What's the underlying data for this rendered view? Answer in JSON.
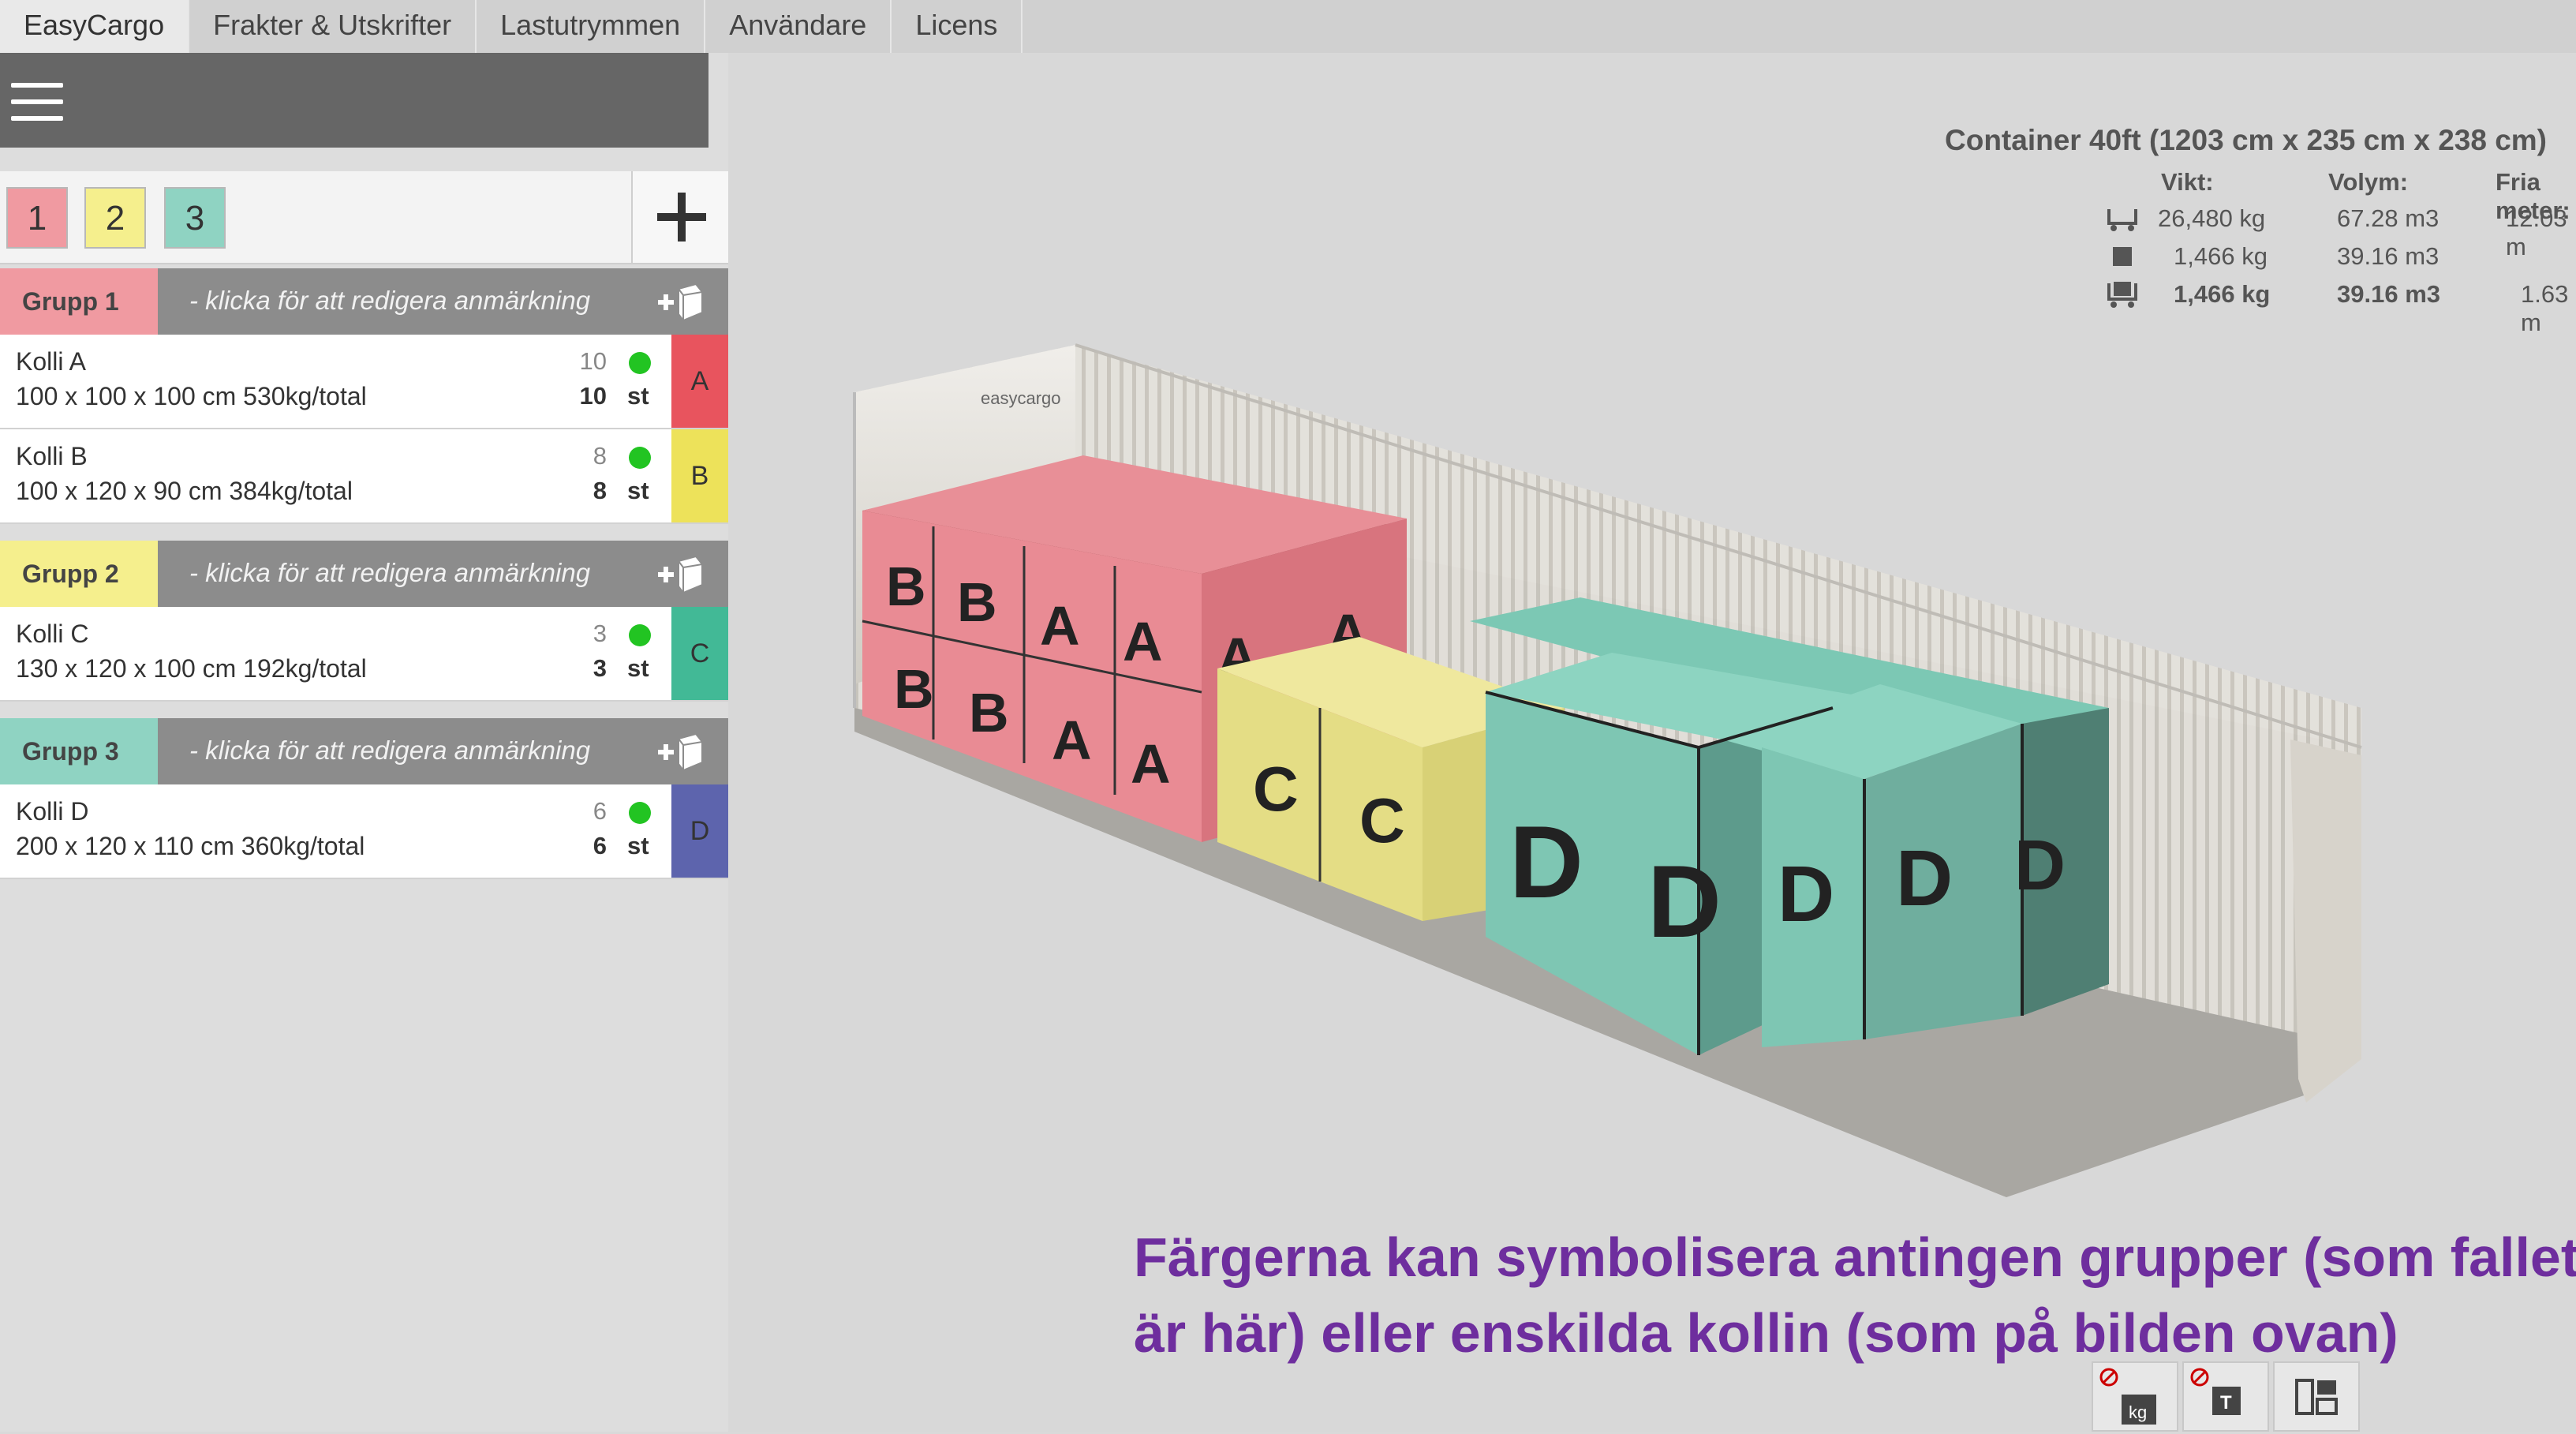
{
  "nav": {
    "tabs": [
      {
        "label": "EasyCargo"
      },
      {
        "label": "Frakter & Utskrifter"
      },
      {
        "label": "Lastutrymmen"
      },
      {
        "label": "Användare"
      },
      {
        "label": "Licens"
      }
    ]
  },
  "group_tabs": [
    "1",
    "2",
    "3"
  ],
  "groups": [
    {
      "label": "Grupp 1",
      "note": "- klicka för att redigera anmärkning",
      "color": "#f09aa1",
      "items": [
        {
          "name": "Kolli A",
          "dims": "100 x 100 x 100 cm 530kg/total",
          "count": "10",
          "count_loaded": "10",
          "unit": "st",
          "tag": "A",
          "tag_color": "#e8545e"
        },
        {
          "name": "Kolli B",
          "dims": "100 x 120 x 90 cm 384kg/total",
          "count": "8",
          "count_loaded": "8",
          "unit": "st",
          "tag": "B",
          "tag_color": "#ede25a"
        }
      ]
    },
    {
      "label": "Grupp 2",
      "note": "- klicka för att redigera anmärkning",
      "color": "#f5ef8d",
      "items": [
        {
          "name": "Kolli C",
          "dims": "130 x 120 x 100 cm 192kg/total",
          "count": "3",
          "count_loaded": "3",
          "unit": "st",
          "tag": "C",
          "tag_color": "#42b996"
        }
      ]
    },
    {
      "label": "Grupp 3",
      "note": "- klicka för att redigera anmärkning",
      "color": "#8fd3c2",
      "items": [
        {
          "name": "Kolli D",
          "dims": "200 x 120 x 110 cm 360kg/total",
          "count": "6",
          "count_loaded": "6",
          "unit": "st",
          "tag": "D",
          "tag_color": "#5d64ad"
        }
      ]
    }
  ],
  "stats": {
    "title": "Container 40ft (1203 cm x 235 cm x 238 cm)",
    "headers": [
      "Vikt:",
      "Volym:",
      "Fria meter:"
    ],
    "rows": [
      {
        "icon": "truck-capacity-icon",
        "weight": "26,480 kg",
        "volume": "67.28 m3",
        "free": "12.03 m"
      },
      {
        "icon": "box-icon",
        "weight": "1,466 kg",
        "volume": "39.16 m3",
        "free": ""
      },
      {
        "icon": "loaded-cargo-icon",
        "weight": "1,466 kg",
        "volume": "39.16 m3",
        "free": "1.63 m"
      }
    ]
  },
  "caption": {
    "line1": "Färgerna kan symbolisera antingen grupper (som fallet",
    "line2": "är här) eller enskilda kollin (som på bilden ovan)"
  },
  "container_brand": "easycargo",
  "tools": [
    {
      "name": "weight-toggle-icon",
      "label": "kg"
    },
    {
      "name": "text-toggle-icon",
      "label": "T"
    },
    {
      "name": "layout-icon",
      "label": ""
    }
  ]
}
